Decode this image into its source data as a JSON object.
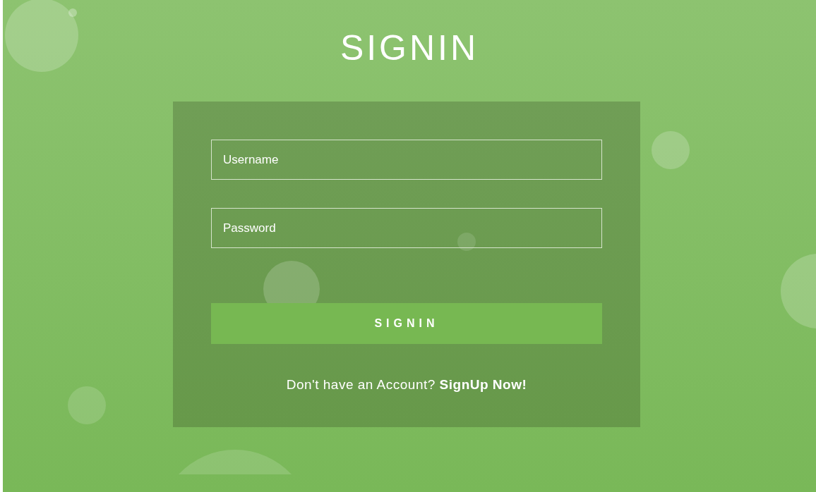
{
  "title": "SIGNIN",
  "fields": [
    {
      "placeholder": "Username"
    },
    {
      "placeholder": "Password"
    }
  ],
  "submit_button": "SIGNIN",
  "signup_prompt": {
    "text": "Don't have an Account?",
    "link": "SignUp Now!"
  }
}
